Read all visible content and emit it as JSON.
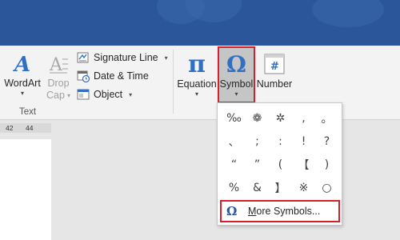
{
  "ribbon": {
    "wordart": {
      "label": "WordArt",
      "icon": "wordart-icon"
    },
    "dropcap": {
      "label_line1": "Drop",
      "label_line2": "Cap",
      "icon": "drop-cap-icon"
    },
    "signature_line": {
      "label": "Signature Line",
      "icon": "signature-line-icon"
    },
    "date_time": {
      "label": "Date & Time",
      "icon": "calendar-icon"
    },
    "object": {
      "label": "Object",
      "icon": "object-icon"
    },
    "text_group_label": "Text",
    "equation": {
      "label": "Equation",
      "glyph": "π",
      "icon": "pi-icon"
    },
    "symbol": {
      "label": "Symbol",
      "glyph": "Ω",
      "icon": "omega-icon"
    },
    "number": {
      "label": "Number",
      "glyph": "#",
      "icon": "number-icon"
    }
  },
  "ruler": {
    "marks": [
      "42",
      "44"
    ]
  },
  "symbol_dropdown": {
    "symbols": [
      "‰",
      "❁",
      "✲",
      ",",
      "。",
      "、",
      ";",
      ":",
      "!",
      "?",
      "“",
      "”",
      "(",
      "【",
      ")",
      "%",
      "&",
      "】",
      "※",
      "○"
    ],
    "more_symbols": {
      "omega": "Ω",
      "label_first": "M",
      "label_rest": "ore Symbols..."
    }
  },
  "colors": {
    "accent": "#2b579a",
    "highlight_border": "#d9202a",
    "ribbon_bg": "#f3f3f3"
  }
}
